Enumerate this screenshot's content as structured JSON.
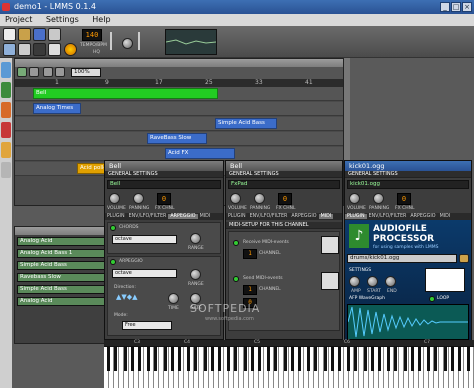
{
  "window": {
    "title": "demo1 - LMMS 0.1.4"
  },
  "menu": [
    "Project",
    "Settings",
    "Help"
  ],
  "toolbar": {
    "tempo": "140",
    "tempo_label": "TEMPO/BPM",
    "hq_label": "HQ"
  },
  "song_editor": {
    "zoom": "100%",
    "timeline": [
      "1",
      "9",
      "17",
      "25",
      "33",
      "41"
    ],
    "tracks": [
      {
        "name": "Bell",
        "color": "#22cc22"
      },
      {
        "name": "Analog Times",
        "color": "#3b6cc9"
      },
      {
        "name": "Simple Acid Bass",
        "color": "#3b6cc9"
      },
      {
        "name": "RaveBass Slow",
        "color": "#3b6cc9"
      },
      {
        "name": "Acid FX",
        "color": "#3b6cc9"
      },
      {
        "name": "Acid pollen",
        "color": "#e0a000"
      }
    ]
  },
  "bb_editor": {
    "rows": [
      "Analog Acid",
      "Analog Acid Bass 1",
      "Simple Acid Bass",
      "Ravebass Slow",
      "Simple Acid Bass",
      "Analog Acid"
    ]
  },
  "windows": [
    {
      "title": "Bell",
      "name_value": "Bell",
      "general": "GENERAL SETTINGS",
      "volume_label": "VOLUME",
      "panning_label": "PANNING",
      "fx_label": "FX CHNL",
      "fx_value": "0",
      "tabs": [
        "PLUGIN",
        "ENV/LFO/FILTER",
        "ARPEGGIO",
        "MIDI"
      ],
      "chords_label": "CHORDS",
      "chord_value": "octave",
      "range_label": "RANGE",
      "arp_label": "ARPEGGIO",
      "arp_value": "octave",
      "arp_range_label": "RANGE",
      "time_label": "TIME",
      "gate_label": "GATE",
      "direction_label": "Direction:",
      "mode_label": "Mode:",
      "mode_value": "Free"
    },
    {
      "title": "Bell",
      "name_value": "FxPad",
      "general": "GENERAL SETTINGS",
      "volume_label": "VOLUME",
      "panning_label": "PANNING",
      "fx_label": "FX CHNL",
      "fx_value": "0",
      "tabs": [
        "PLUGIN",
        "ENV/LFO/FILTER",
        "ARPEGGIO",
        "MIDI"
      ],
      "midi_header": "MIDI-SETUP FOR THIS CHANNEL",
      "receive_label": "Receive MIDI-events",
      "send_label": "Send MIDI-events",
      "channel_label": "CHANNEL",
      "channel_value": "1",
      "note_value": "0"
    },
    {
      "title": "kick01.ogg",
      "name_value": "kick01.ogg",
      "general": "GENERAL SETTINGS",
      "volume_label": "VOLUME",
      "panning_label": "PANNING",
      "fx_label": "FX CHNL",
      "fx_value": "0",
      "tabs": [
        "PLUGIN",
        "ENV/LFO/FILTER",
        "ARPEGGIO",
        "MIDI"
      ],
      "logo_line1": "AUDIOFILE",
      "logo_line2": "PROCESSOR",
      "logo_sub": "for using samples with LMMS",
      "file_path": "drums/kick01.ogg",
      "settings_label": "SETTINGS",
      "amp_label": "AMP",
      "start_label": "START",
      "end_label": "END",
      "graph_label": "AFP WaveGraph",
      "loop_label": "LOOP"
    }
  ],
  "keyboard": {
    "octaves": [
      "C3",
      "C4",
      "C5",
      "C6",
      "C7"
    ]
  },
  "watermark": "SOFTPEDIA",
  "watermark_url": "www.softpedia.com"
}
